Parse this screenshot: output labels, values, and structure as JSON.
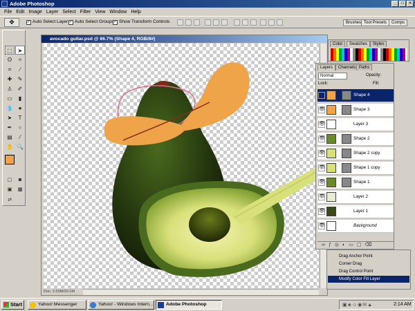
{
  "app": {
    "title": "Adobe Photoshop"
  },
  "menu": [
    "File",
    "Edit",
    "Image",
    "Layer",
    "Select",
    "Filter",
    "View",
    "Window",
    "Help"
  ],
  "options": {
    "auto_select_layer": "Auto Select Layer",
    "auto_select_groups": "Auto Select Groups",
    "show_transform_controls": "Show Transform Controls",
    "right_tabs": [
      "Brushes",
      "Tool Presets",
      "Comps"
    ]
  },
  "document": {
    "title": "avocado guitar.psd @ 66.7% (Shape 4, RGB/8#)",
    "status": "Doc: 2.53M/20.1M"
  },
  "swatches_panel": {
    "tabs": [
      "Color",
      "Swatches",
      "Styles"
    ]
  },
  "layers_panel": {
    "tabs": [
      "Layers",
      "Channels",
      "Paths"
    ],
    "blend_mode": "Normal",
    "opacity_label": "Opacity:",
    "fill_label": "Fill:",
    "lock_label": "Lock:",
    "layers": [
      {
        "name": "Shape 4",
        "selected": true,
        "thumb_color": "#f0a44a"
      },
      {
        "name": "Shape 3",
        "selected": false,
        "thumb_color": "#f0a44a"
      },
      {
        "name": "Layer 3",
        "selected": false,
        "thumb_color": "#ffffff"
      },
      {
        "name": "Shape 2",
        "selected": false,
        "thumb_color": "#6b8a2a"
      },
      {
        "name": "Shape 2 copy",
        "selected": false,
        "thumb_color": "#d8e07a"
      },
      {
        "name": "Shape 1 copy",
        "selected": false,
        "thumb_color": "#d8e07a"
      },
      {
        "name": "Shape 1",
        "selected": false,
        "thumb_color": "#6b8a2a"
      },
      {
        "name": "Layer 2",
        "selected": false,
        "thumb_color": "#e8ecd0"
      },
      {
        "name": "Layer 1",
        "selected": false,
        "thumb_color": "#3a4a1a"
      },
      {
        "name": "Background",
        "selected": false,
        "thumb_color": "#ffffff"
      }
    ]
  },
  "history_panel": {
    "items": [
      {
        "label": "Drag Anchor Point",
        "selected": false
      },
      {
        "label": "Corner Drag",
        "selected": false
      },
      {
        "label": "Drag Control Point",
        "selected": false
      },
      {
        "label": "Modify Color Fill Layer",
        "selected": true
      }
    ]
  },
  "taskbar": {
    "start": "Start",
    "buttons": [
      "Yahoo! Messenger",
      "Yahoo! - Windows Intern...",
      "Adobe Photoshop"
    ],
    "clock": "2:14 AM"
  },
  "colors": {
    "foreground": "#f0a44a",
    "background": "#3f5f1a",
    "accent": "#0a246a"
  }
}
